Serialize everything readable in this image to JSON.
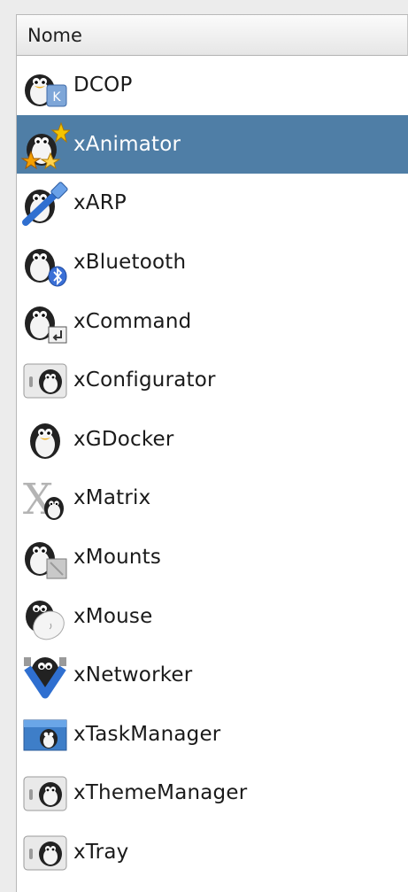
{
  "table": {
    "column_header": "Nome",
    "selected_index": 1,
    "items": [
      {
        "label": "DCOP",
        "icon": "tux-dcop-icon"
      },
      {
        "label": "xAnimator",
        "icon": "tux-animator-stars-icon"
      },
      {
        "label": "xARP",
        "icon": "tux-network-cable-icon"
      },
      {
        "label": "xBluetooth",
        "icon": "tux-bluetooth-icon"
      },
      {
        "label": "xCommand",
        "icon": "tux-terminal-command-icon"
      },
      {
        "label": "xConfigurator",
        "icon": "tux-configurator-icon"
      },
      {
        "label": "xGDocker",
        "icon": "tux-docker-icon"
      },
      {
        "label": "xMatrix",
        "icon": "x-matrix-tux-icon"
      },
      {
        "label": "xMounts",
        "icon": "tux-mounts-disk-icon"
      },
      {
        "label": "xMouse",
        "icon": "tux-mouse-icon"
      },
      {
        "label": "xNetworker",
        "icon": "tux-networker-icon"
      },
      {
        "label": "xTaskManager",
        "icon": "tux-task-manager-icon"
      },
      {
        "label": "xThemeManager",
        "icon": "tux-theme-manager-icon"
      },
      {
        "label": "xTray",
        "icon": "tux-tray-icon"
      }
    ]
  },
  "colors": {
    "selection": "#4f7ea6",
    "header_bg": "#e6e6e6"
  }
}
